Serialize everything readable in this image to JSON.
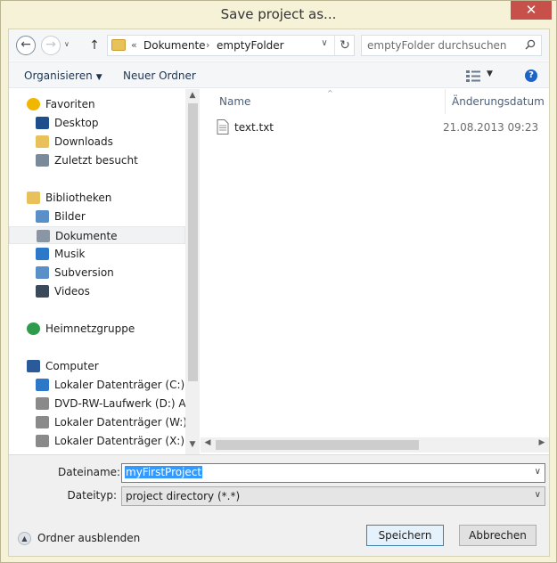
{
  "window": {
    "title": "Save project as...",
    "close_glyph": "✕"
  },
  "address_bar": {
    "back_glyph": "←",
    "forward_glyph": "→",
    "up_glyph": "↑",
    "overflow_glyph": "«",
    "crumbs": [
      "Dokumente",
      "emptyFolder"
    ],
    "separator_glyph": "›",
    "dropdown_glyph": "∨",
    "refresh_glyph": "↻",
    "search_placeholder": "emptyFolder durchsuchen"
  },
  "toolbar": {
    "organize_label": "Organisieren",
    "organize_caret": "▼",
    "new_folder_label": "Neuer Ordner",
    "view_caret": "▼",
    "help_glyph": "?"
  },
  "nav_pane": {
    "items": [
      {
        "label": "Favoriten",
        "icon": "star-icon",
        "color": "#f2b600"
      },
      {
        "label": "Desktop",
        "icon": "desktop-icon",
        "color": "#1f4e8c"
      },
      {
        "label": "Downloads",
        "icon": "downloads-icon",
        "color": "#e8c15a"
      },
      {
        "label": "Zuletzt besucht",
        "icon": "recent-places-icon",
        "color": "#7a8a9a"
      },
      {
        "label": "Bibliotheken",
        "icon": "libraries-icon",
        "color": "#e8c15a"
      },
      {
        "label": "Bilder",
        "icon": "pictures-icon",
        "color": "#5a8fc7"
      },
      {
        "label": "Dokumente",
        "icon": "documents-icon",
        "color": "#8a96a3",
        "selected": true
      },
      {
        "label": "Musik",
        "icon": "music-icon",
        "color": "#2d78c8"
      },
      {
        "label": "Subversion",
        "icon": "subversion-icon",
        "color": "#5a8fc7"
      },
      {
        "label": "Videos",
        "icon": "videos-icon",
        "color": "#3a4a5a"
      },
      {
        "label": "Heimnetzgruppe",
        "icon": "homegroup-icon",
        "color": "#2e9c4a"
      },
      {
        "label": "Computer",
        "icon": "computer-icon",
        "color": "#2a5a9a"
      },
      {
        "label": "Lokaler Datenträger (C:)",
        "icon": "system-drive-icon",
        "color": "#2d78c8"
      },
      {
        "label": "DVD-RW-Laufwerk (D:) Audi",
        "icon": "dvd-drive-icon",
        "color": "#8a8a8a"
      },
      {
        "label": "Lokaler Datenträger (W:)",
        "icon": "drive-icon",
        "color": "#8a8a8a"
      },
      {
        "label": "Lokaler Datenträger (X:)",
        "icon": "drive-icon",
        "color": "#8a8a8a"
      }
    ],
    "scroll_up_glyph": "▲",
    "scroll_down_glyph": "▼"
  },
  "file_list": {
    "columns": [
      "Name",
      "Änderungsdatum"
    ],
    "sort_glyph": "^",
    "files": [
      {
        "name": "text.txt",
        "modified": "21.08.2013 09:23",
        "icon": "text-file-icon"
      }
    ],
    "scroll_left_glyph": "◀",
    "scroll_right_glyph": "▶"
  },
  "form": {
    "filename_label": "Dateiname:",
    "filename_value": "myFirstProject",
    "filetype_label": "Dateityp:",
    "filetype_value": "project directory (*.*)",
    "dropdown_glyph": "∨",
    "hide_folders_label": "Ordner ausblenden",
    "hide_folders_glyph": "▲",
    "save_label": "Speichern",
    "cancel_label": "Abbrechen"
  }
}
